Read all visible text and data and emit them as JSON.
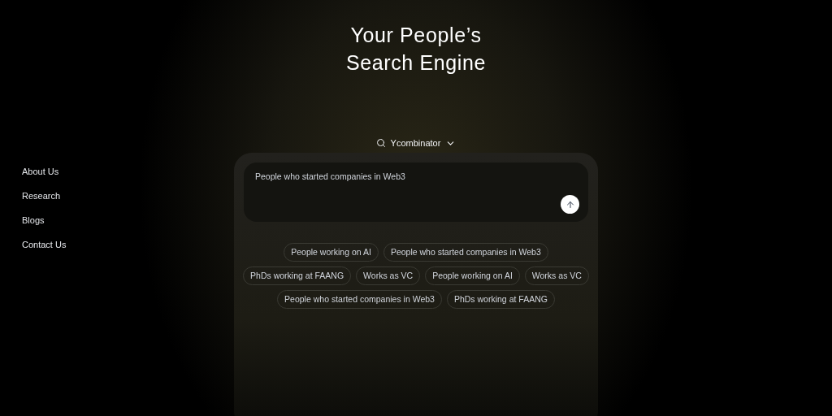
{
  "title_lines": [
    "Your People’s",
    "Search Engine"
  ],
  "source_selector": {
    "label": "Ycombinator"
  },
  "nav": [
    {
      "label": "About Us"
    },
    {
      "label": "Research"
    },
    {
      "label": "Blogs"
    },
    {
      "label": "Contact Us"
    }
  ],
  "query": {
    "value": "People who started companies in Web3"
  },
  "suggestion_rows": [
    [
      "People working on AI",
      "People who started companies in Web3"
    ],
    [
      "PhDs working at FAANG",
      "Works as VC",
      "People working on AI",
      "Works as VC"
    ],
    [
      "People who started companies in Web3",
      "PhDs working at FAANG"
    ]
  ]
}
